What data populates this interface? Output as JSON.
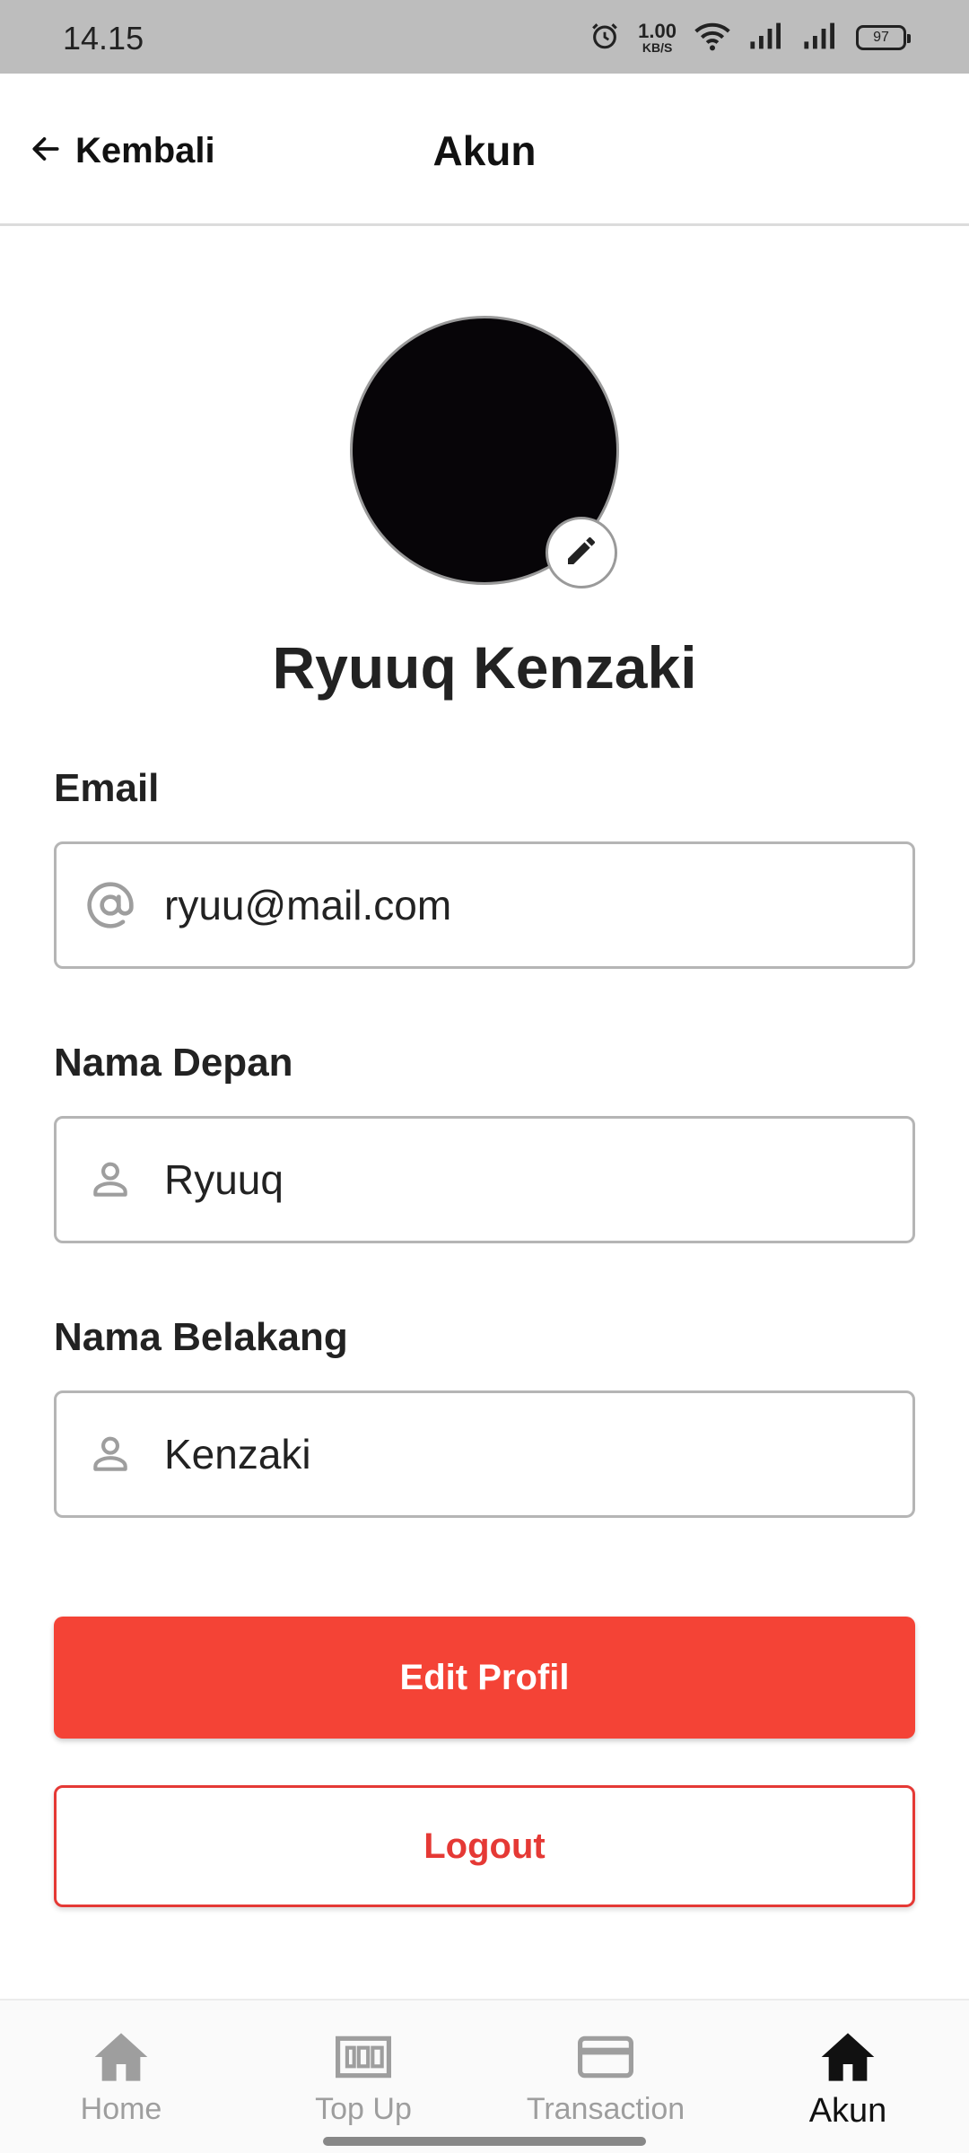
{
  "status_bar": {
    "time": "14.15",
    "net_speed_value": "1.00",
    "net_speed_unit": "KB/S",
    "battery": "97"
  },
  "header": {
    "back_label": "Kembali",
    "title": "Akun"
  },
  "profile": {
    "name": "Ryuuq Kenzaki"
  },
  "form": {
    "email": {
      "label": "Email",
      "value": "ryuu@mail.com",
      "icon": "at-icon"
    },
    "first_name": {
      "label": "Nama Depan",
      "value": "Ryuuq",
      "icon": "person-icon"
    },
    "last_name": {
      "label": "Nama Belakang",
      "value": "Kenzaki",
      "icon": "person-icon"
    }
  },
  "actions": {
    "edit_label": "Edit Profil",
    "logout_label": "Logout"
  },
  "bottom_nav": {
    "items": [
      {
        "label": "Home",
        "icon": "home-icon",
        "active": false
      },
      {
        "label": "Top Up",
        "icon": "money-icon",
        "active": false
      },
      {
        "label": "Transaction",
        "icon": "credit-card-icon",
        "active": false
      },
      {
        "label": "Akun",
        "icon": "home-icon",
        "active": true
      }
    ]
  },
  "colors": {
    "primary": "#f44336",
    "outline": "#e53935",
    "status_bar": "#bdbdbd"
  }
}
